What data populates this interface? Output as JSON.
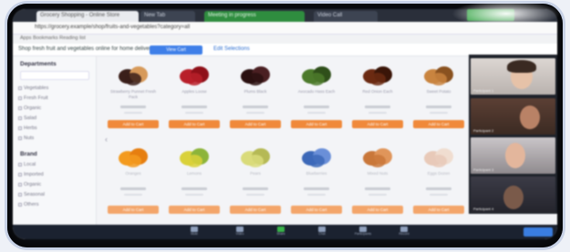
{
  "browser": {
    "tabs": [
      {
        "label": "Grocery Shopping - Online Store"
      },
      {
        "label": "New Tab"
      },
      {
        "label": "Meeting in progress"
      },
      {
        "label": "Video Call"
      }
    ],
    "url": "https://grocery.example/shop/fruits-and-vegetables?category=all",
    "bookmarks": "Apps  Bookmarks  Reading list"
  },
  "page": {
    "title": "Shop fresh fruit and vegetables online for home delivery",
    "primary_button": "View Cart",
    "link": "Edit Selections"
  },
  "sidebar": {
    "heading": "Departments",
    "filters": [
      "Vegetables",
      "Fresh Fruit",
      "Organic",
      "Salad",
      "Herbs",
      "Nuts"
    ],
    "heading_2": "Brand",
    "brands": [
      "Local",
      "Imported",
      "Organic",
      "Seasonal",
      "Others"
    ]
  },
  "products_row1": [
    {
      "name": "Strawberry Punnet Fresh Pack",
      "button": "Add to Cart",
      "color": "#3a1f1a",
      "accent": "#d79a5a"
    },
    {
      "name": "Apples Loose",
      "button": "Add to Cart",
      "color": "#b8202a",
      "accent": "#8f1019"
    },
    {
      "name": "Plums Black",
      "button": "Add to Cart",
      "color": "#2a1010",
      "accent": "#4a1f22"
    },
    {
      "name": "Avocado Hass Each",
      "button": "Add to Cart",
      "color": "#4c7a2b",
      "accent": "#2f4f1a"
    },
    {
      "name": "Red Onion Each",
      "button": "Add to Cart",
      "color": "#6b2a12",
      "accent": "#3a1508"
    },
    {
      "name": "Sweet Potato",
      "button": "Add to Cart",
      "color": "#c9843f",
      "accent": "#8a5220"
    }
  ],
  "products_row2": [
    {
      "name": "Oranges",
      "button": "Add to Cart",
      "color": "#f39a1e",
      "accent": "#e67e10"
    },
    {
      "name": "Lemons",
      "button": "Add to Cart",
      "color": "#d9d13a",
      "accent": "#8cb43a"
    },
    {
      "name": "Pears",
      "button": "Add to Cart",
      "color": "#d9db7a",
      "accent": "#b5b955"
    },
    {
      "name": "Blueberries",
      "button": "Add to Cart",
      "color": "#3c68b8",
      "accent": "#6a8fd8"
    },
    {
      "name": "Mixed Nuts",
      "button": "Add to Cart",
      "color": "#c9773a",
      "accent": "#e0955a"
    },
    {
      "name": "Eggs Dozen",
      "button": "Add to Cart",
      "color": "#e8c9b8",
      "accent": "#f0ddd0"
    }
  ],
  "participants": [
    {
      "name": "Participant 1"
    },
    {
      "name": "Participant 2"
    },
    {
      "name": "Participant 3"
    },
    {
      "name": "Participant 4"
    }
  ],
  "taskbar": [
    "Mute",
    "Video",
    "Share",
    "Chat",
    "Participants",
    "Record"
  ]
}
